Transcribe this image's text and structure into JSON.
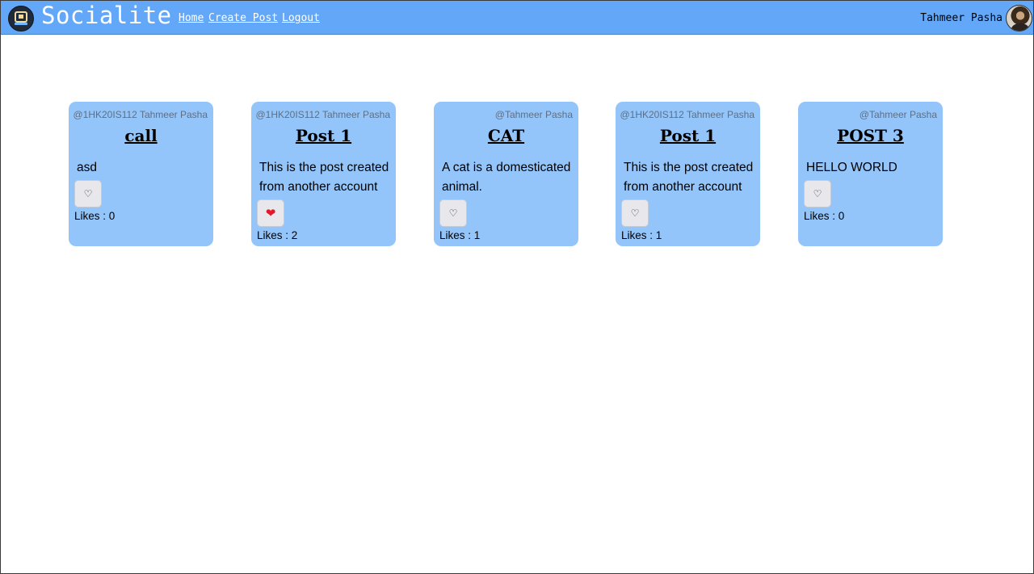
{
  "header": {
    "brand": "Socialite",
    "logo_icon": "socialite-logo-icon",
    "nav": [
      "Home",
      "Create Post",
      "Logout"
    ],
    "user_name": "Tahmeer Pasha",
    "avatar_icon": "user-avatar",
    "bar_color": "#63a7f8"
  },
  "posts": [
    {
      "author": "@1HK20IS112 Tahmeer Pasha",
      "title": "call",
      "body": "asd",
      "liked": false,
      "likes_label": "Likes : 0"
    },
    {
      "author": "@1HK20IS112 Tahmeer Pasha",
      "title": "Post 1",
      "body": "This is the post created from another account",
      "liked": true,
      "likes_label": "Likes : 2"
    },
    {
      "author": "@Tahmeer Pasha",
      "title": "CAT",
      "body": "A cat is a domesticated animal.",
      "liked": false,
      "likes_label": "Likes : 1"
    },
    {
      "author": "@1HK20IS112 Tahmeer Pasha",
      "title": "Post 1",
      "body": "This is the post created from another account",
      "liked": false,
      "likes_label": "Likes : 1"
    },
    {
      "author": "@Tahmeer Pasha",
      "title": "POST 3",
      "body": "HELLO WORLD",
      "liked": false,
      "likes_label": "Likes : 0"
    }
  ],
  "icons": {
    "heart_outline": "♡",
    "heart_filled": "❤"
  },
  "colors": {
    "card": "#93c5fa",
    "liked_heart": "#e0192a"
  }
}
